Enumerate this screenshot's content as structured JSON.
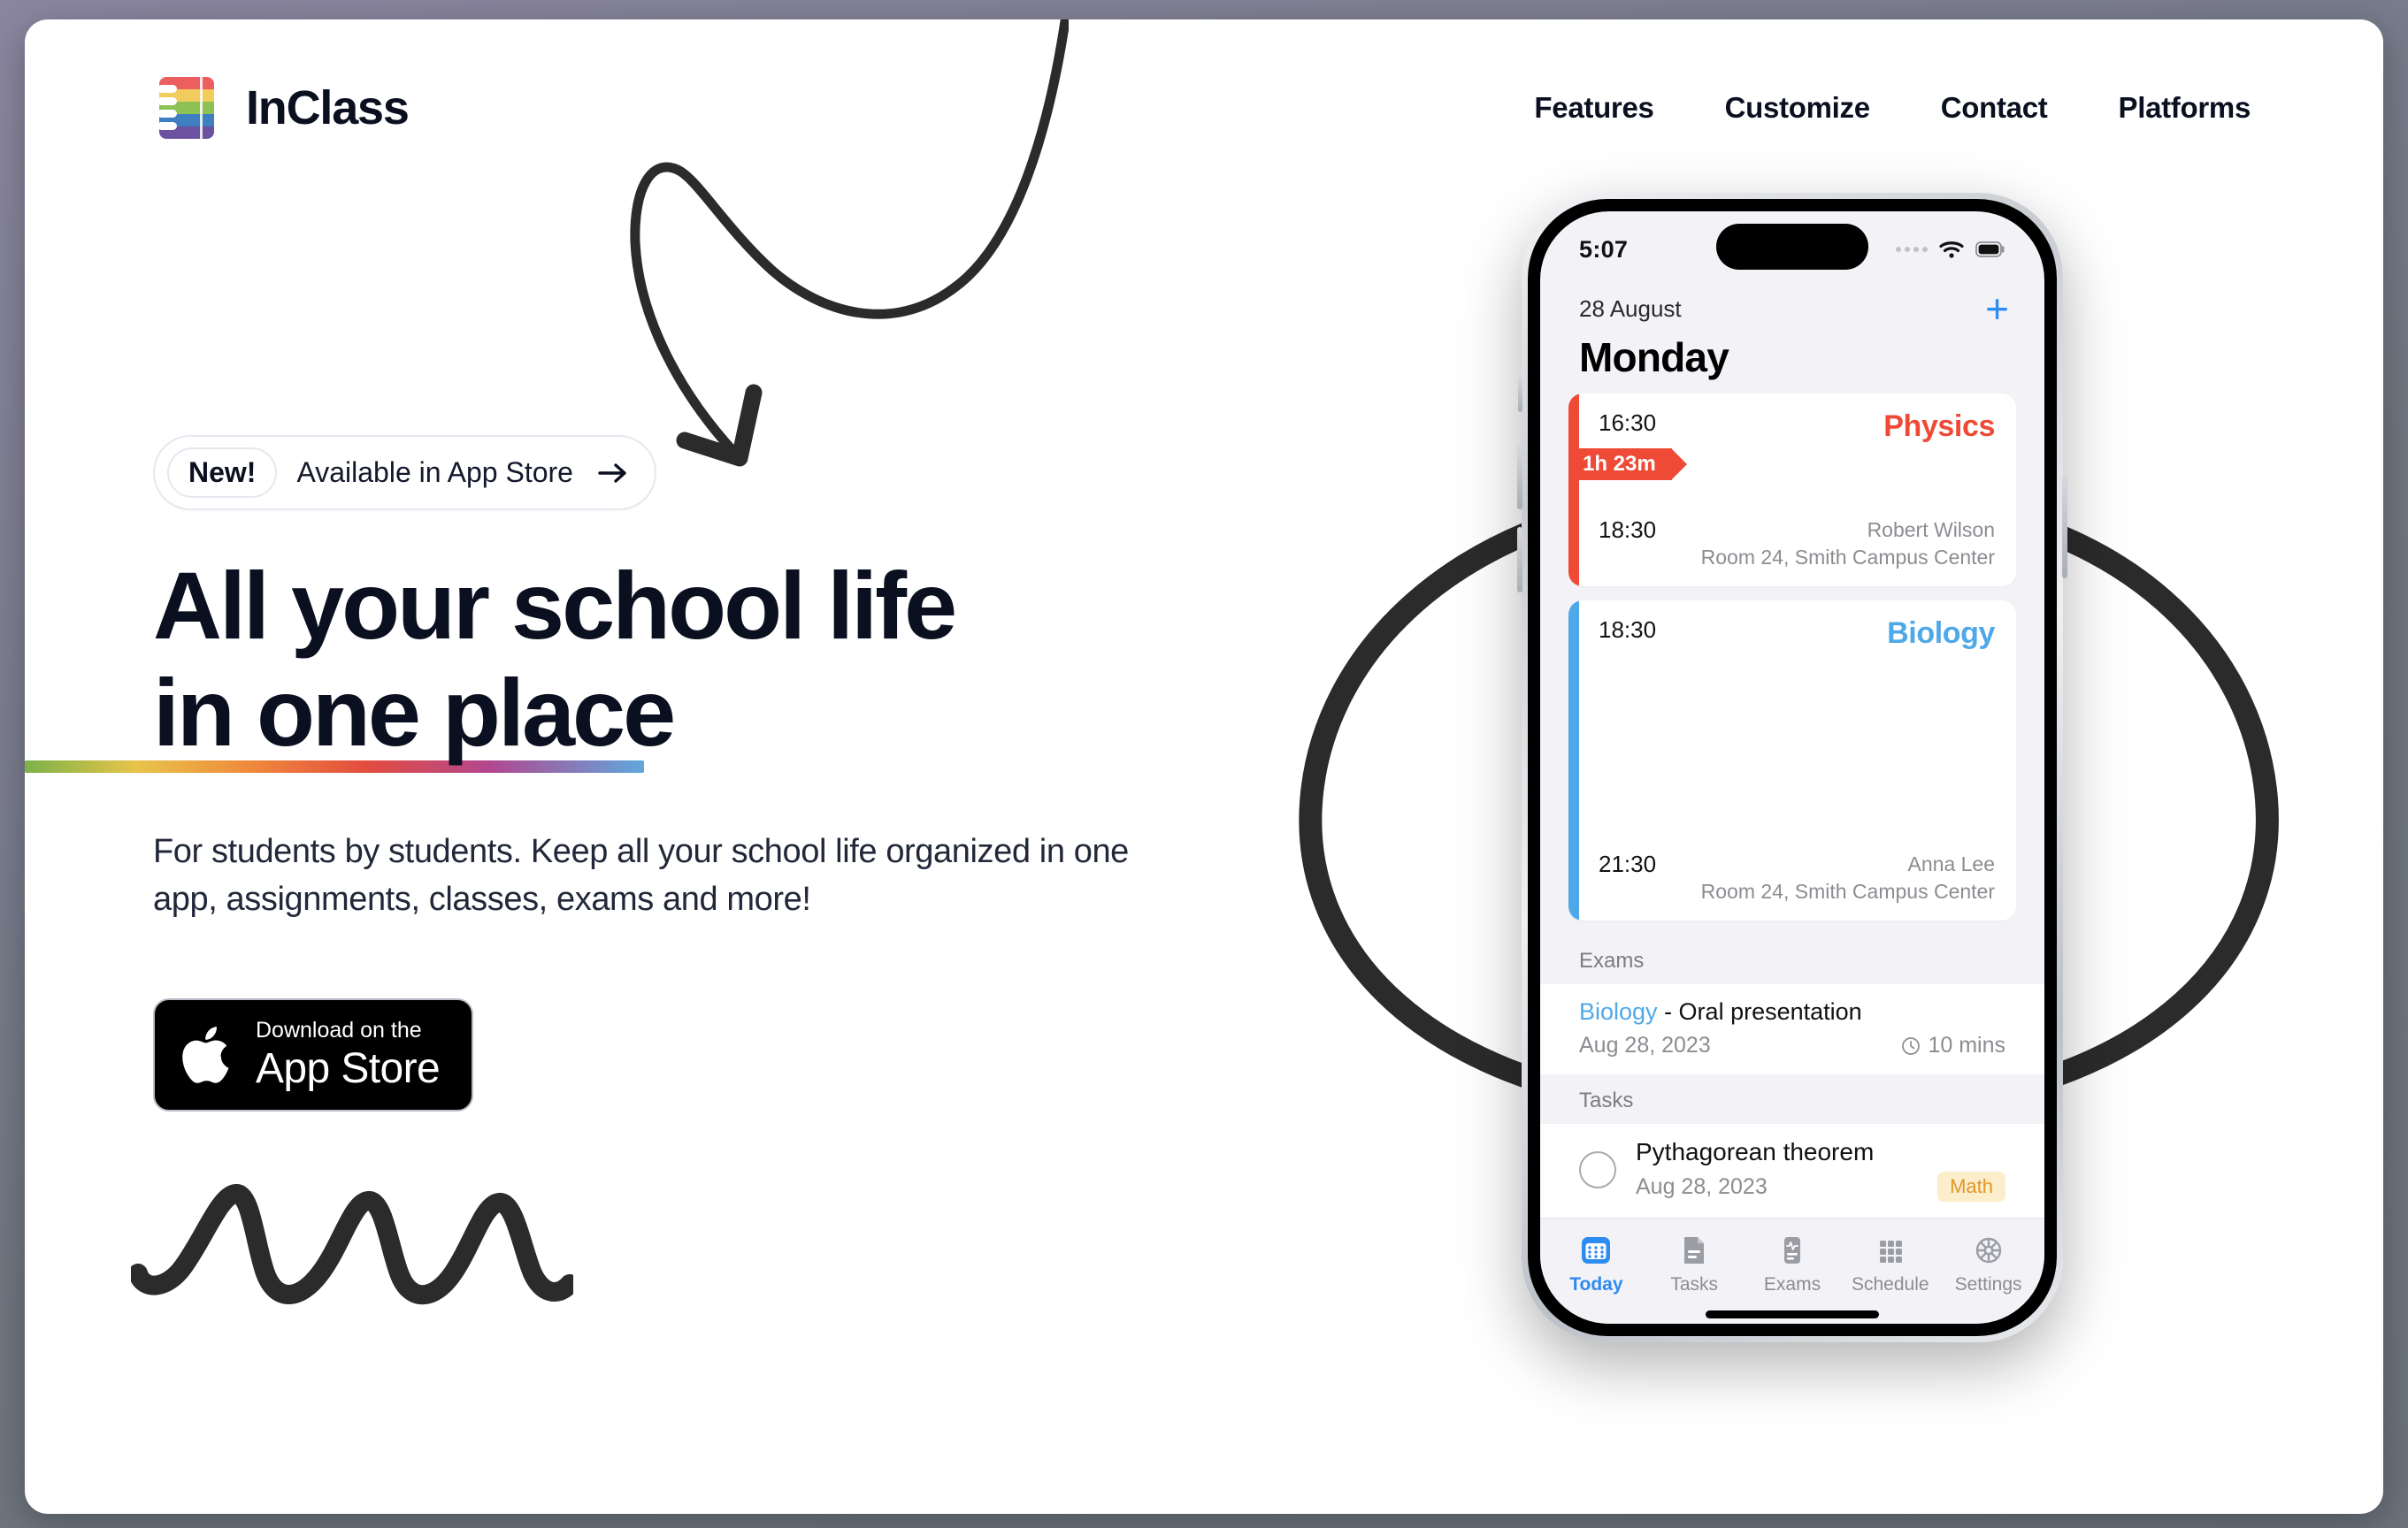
{
  "brand": {
    "name": "InClass",
    "logo_icon": "notebook-rainbow-icon"
  },
  "nav": {
    "items": [
      {
        "label": "Features"
      },
      {
        "label": "Customize"
      },
      {
        "label": "Contact"
      },
      {
        "label": "Platforms"
      }
    ]
  },
  "hero": {
    "pill": {
      "chip": "New!",
      "text": "Available in App Store",
      "arrow_icon": "arrow-right-icon"
    },
    "headline_line1": "All your school life",
    "headline_line2": "in one place",
    "subtitle": "For students by students. Keep all your school life organized in one app, assignments, classes, exams and more!",
    "underline_gradient": [
      "#7bb24a",
      "#e8c44a",
      "#ef8b3c",
      "#e34d3f",
      "#b2478f",
      "#5fa8dd"
    ]
  },
  "appstore": {
    "small_label": "Download on the",
    "big_label": "App Store",
    "icon": "apple-logo-icon"
  },
  "phone": {
    "status": {
      "time": "5:07",
      "signal_icon": "signal-dots-icon",
      "wifi_icon": "wifi-icon",
      "battery_icon": "battery-icon"
    },
    "app": {
      "date": "28 August",
      "day": "Monday",
      "add_icon": "plus-icon",
      "classes": [
        {
          "start": "16:30",
          "end": "18:30",
          "title": "Physics",
          "color": "#ef4a35",
          "duration": "1h 23m",
          "teacher": "Robert Wilson",
          "room": "Room 24, Smith Campus Center"
        },
        {
          "start": "18:30",
          "end": "21:30",
          "title": "Biology",
          "color": "#4fa8e8",
          "duration": "",
          "teacher": "Anna Lee",
          "room": "Room 24, Smith Campus Center"
        }
      ],
      "exams_header": "Exams",
      "exams": [
        {
          "subject": "Biology",
          "title": " - Oral presentation",
          "date": "Aug 28, 2023",
          "duration": "10 mins",
          "clock_icon": "clock-icon"
        }
      ],
      "tasks_header": "Tasks",
      "tasks": [
        {
          "title": "Pythagorean theorem",
          "date": "Aug 28, 2023",
          "tag": "Math",
          "checkbox_icon": "circle-unchecked-icon"
        }
      ],
      "tabs": [
        {
          "label": "Today",
          "icon": "calendar-icon",
          "active": true
        },
        {
          "label": "Tasks",
          "icon": "document-icon",
          "active": false
        },
        {
          "label": "Exams",
          "icon": "clipboard-pulse-icon",
          "active": false
        },
        {
          "label": "Schedule",
          "icon": "grid-icon",
          "active": false
        },
        {
          "label": "Settings",
          "icon": "gear-icon",
          "active": false
        }
      ]
    }
  },
  "doodles": {
    "arrow": "hand-drawn-curved-arrow",
    "squiggle": "hand-drawn-zigzag-squiggle",
    "circle": "hand-drawn-circle"
  }
}
